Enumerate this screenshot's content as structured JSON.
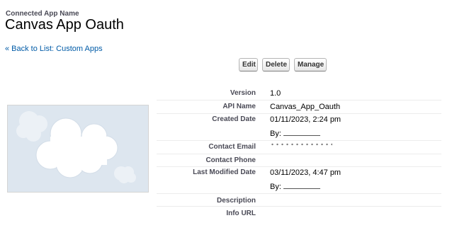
{
  "header": {
    "subtitle": "Connected App Name",
    "title": "Canvas App Oauth"
  },
  "back_link": "« Back to List: Custom Apps",
  "toolbar": {
    "edit_label": "Edit",
    "delete_label": "Delete",
    "manage_label": "Manage"
  },
  "logo": {
    "background_color": "#dde6ef",
    "cloud_color": "#ffffff",
    "icon": "cloud-icon"
  },
  "details": {
    "version_label": "Version",
    "version_value": "1.0",
    "api_name_label": "API Name",
    "api_name_value": "Canvas_App_Oauth",
    "created_date_label": "Created Date",
    "created_date_value": "01/11/2023, 2:24 pm",
    "created_by_prefix": "By:",
    "contact_email_label": "Contact Email",
    "contact_phone_label": "Contact Phone",
    "last_modified_label": "Last Modified Date",
    "last_modified_value": "03/11/2023, 4:47 pm",
    "modified_by_prefix": "By:",
    "description_label": "Description",
    "info_url_label": "Info URL"
  },
  "colors": {
    "link": "#015ba7",
    "label": "#4a4a56",
    "divider": "#ececec"
  }
}
